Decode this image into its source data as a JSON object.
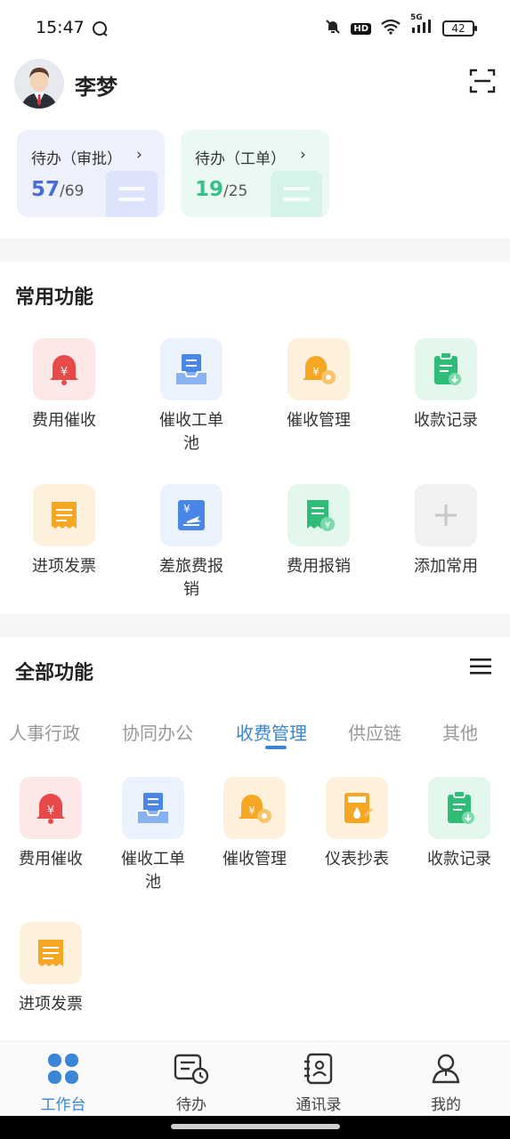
{
  "status": {
    "time": "15:47",
    "network": "5G",
    "hd": "HD",
    "battery": "42"
  },
  "profile": {
    "name": "李梦"
  },
  "todos": [
    {
      "title": "待办（审批）",
      "done": "57",
      "total": "/69"
    },
    {
      "title": "待办（工单）",
      "done": "19",
      "total": "/25"
    }
  ],
  "common": {
    "title": "常用功能",
    "items": [
      {
        "label": "费用催收",
        "icon": "bell-yen-icon",
        "color": "#e84a4a"
      },
      {
        "label": "催收工单池",
        "icon": "tray-document-icon",
        "color": "#4a86e8"
      },
      {
        "label": "催收管理",
        "icon": "bell-settings-icon",
        "color": "#f5a623"
      },
      {
        "label": "收款记录",
        "icon": "clipboard-download-icon",
        "color": "#2ebc78"
      },
      {
        "label": "进项发票",
        "icon": "receipt-icon",
        "color": "#f5a623"
      },
      {
        "label": "差旅费报销",
        "icon": "travel-expense-icon",
        "color": "#4a86e8"
      },
      {
        "label": "费用报销",
        "icon": "document-yen-icon",
        "color": "#2ebc78"
      },
      {
        "label": "添加常用",
        "icon": "plus-icon",
        "color": "#cccccc"
      }
    ]
  },
  "all": {
    "title": "全部功能",
    "tabs": [
      "人事行政",
      "协同办公",
      "收费管理",
      "供应链",
      "其他"
    ],
    "active_tab": "收费管理",
    "items": [
      {
        "label": "费用催收",
        "icon": "bell-yen-icon"
      },
      {
        "label": "催收工单池",
        "icon": "tray-document-icon"
      },
      {
        "label": "催收管理",
        "icon": "bell-settings-icon"
      },
      {
        "label": "仪表抄表",
        "icon": "meter-reading-icon"
      },
      {
        "label": "收款记录",
        "icon": "clipboard-download-icon"
      },
      {
        "label": "进项发票",
        "icon": "receipt-icon"
      }
    ]
  },
  "nav": [
    {
      "label": "工作台",
      "icon": "grid-four-icon",
      "active": true
    },
    {
      "label": "待办",
      "icon": "todo-clock-icon",
      "active": false
    },
    {
      "label": "通讯录",
      "icon": "contacts-book-icon",
      "active": false
    },
    {
      "label": "我的",
      "icon": "person-icon",
      "active": false
    }
  ],
  "colors": {
    "accent": "#3a86d6",
    "red": "#e84a4a",
    "blue": "#4a86e8",
    "orange": "#f5a623",
    "green": "#2ebc78"
  }
}
